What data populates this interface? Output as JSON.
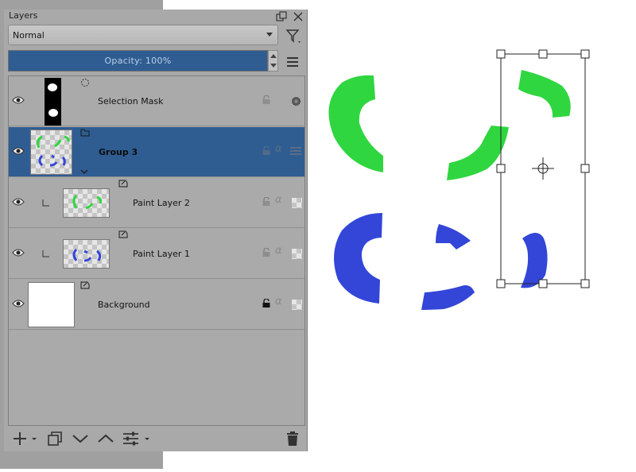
{
  "panel": {
    "title": "Layers",
    "blend_mode": "Normal",
    "opacity_label": "Opacity:  100%"
  },
  "layers": [
    {
      "name": "Selection Mask",
      "selected": false
    },
    {
      "name": "Group 3",
      "selected": true
    },
    {
      "name": "Paint Layer 2",
      "selected": false
    },
    {
      "name": "Paint Layer 1",
      "selected": false
    },
    {
      "name": "Background",
      "selected": false
    }
  ],
  "colors": {
    "selection": "#2f5d92",
    "panel_bg": "#a9a9a9",
    "stroke_green": "#2fd63f",
    "stroke_blue": "#3346d8"
  },
  "icons": [
    "float-icon",
    "close-icon",
    "filter-icon",
    "menu-icon",
    "eye-icon",
    "lock-icon",
    "alpha-icon",
    "add-icon",
    "duplicate-icon",
    "move-down-icon",
    "move-up-icon",
    "properties-icon",
    "delete-icon",
    "transform-handle-icon"
  ]
}
